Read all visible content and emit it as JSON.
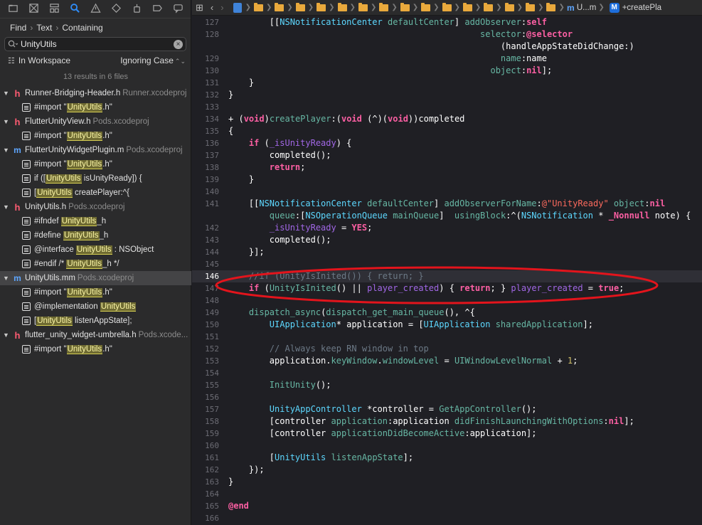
{
  "navigator": {
    "tabs": [
      {
        "name": "project-navigator-tab",
        "icon": "folder-icon"
      },
      {
        "name": "source-control-tab",
        "icon": "source-control-icon"
      },
      {
        "name": "symbol-navigator-tab",
        "icon": "hierarchy-icon"
      },
      {
        "name": "find-navigator-tab",
        "icon": "search-icon",
        "active": true
      },
      {
        "name": "issue-navigator-tab",
        "icon": "warning-icon"
      },
      {
        "name": "test-navigator-tab",
        "icon": "test-diamond-icon"
      },
      {
        "name": "debug-navigator-tab",
        "icon": "spray-icon"
      },
      {
        "name": "breakpoint-navigator-tab",
        "icon": "breakpoint-icon"
      },
      {
        "name": "report-navigator-tab",
        "icon": "report-bubble-icon"
      }
    ],
    "find_path": [
      "Find",
      "Text",
      "Containing"
    ],
    "search_value": "UnityUtils",
    "scope_label": "In Workspace",
    "case_label": "Ignoring Case",
    "results_summary": "13 results in 6 files",
    "highlight_color": "#6e6a32",
    "results": [
      {
        "type": "file",
        "icon": "h",
        "name": "Runner-Bridging-Header.h",
        "project": "Runner.xcodeproj",
        "matches": [
          {
            "pre": "#import \"",
            "hit": "UnityUtils",
            "post": ".h\""
          }
        ]
      },
      {
        "type": "file",
        "icon": "h",
        "name": "FlutterUnityView.h",
        "project": "Pods.xcodeproj",
        "matches": [
          {
            "pre": "#import \"",
            "hit": "UnityUtils",
            "post": ".h\""
          }
        ]
      },
      {
        "type": "file",
        "icon": "m",
        "name": "FlutterUnityWidgetPlugin.m",
        "project": "Pods.xcodeproj",
        "matches": [
          {
            "pre": "#import \"",
            "hit": "UnityUtils",
            "post": ".h\""
          },
          {
            "pre": "if ([",
            "hit": "UnityUtils",
            "post": " isUnityReady]) {"
          },
          {
            "pre": "[",
            "hit": "UnityUtils",
            "post": " createPlayer:^{"
          }
        ]
      },
      {
        "type": "file",
        "icon": "h",
        "name": "UnityUtils.h",
        "project": "Pods.xcodeproj",
        "matches": [
          {
            "pre": "#ifndef ",
            "hit": "UnityUtils",
            "post": "_h"
          },
          {
            "pre": "#define ",
            "hit": "UnityUtils",
            "post": "_h"
          },
          {
            "pre": "@interface ",
            "hit": "UnityUtils",
            "post": " : NSObject"
          },
          {
            "pre": "#endif /* ",
            "hit": "UnityUtils",
            "post": "_h */"
          }
        ]
      },
      {
        "type": "file",
        "icon": "m",
        "name": "UnityUtils.mm",
        "project": "Pods.xcodeproj",
        "selected": true,
        "matches": [
          {
            "pre": "#import \"",
            "hit": "UnityUtils",
            "post": ".h\""
          },
          {
            "pre": "@implementation ",
            "hit": "UnityUtils",
            "post": ""
          },
          {
            "pre": "[",
            "hit": "UnityUtils",
            "post": " listenAppState];"
          }
        ]
      },
      {
        "type": "file",
        "icon": "h",
        "name": "flutter_unity_widget-umbrella.h",
        "project": "Pods.xcode...",
        "matches": [
          {
            "pre": "#import \"",
            "hit": "UnityUtils",
            "post": ".h\""
          }
        ]
      }
    ]
  },
  "jumpbar": {
    "grid_icon": "grid-icon",
    "back_icon": "chevron-left-icon",
    "forward_icon": "chevron-right-icon",
    "folder_count": 15,
    "file_label": "U...m",
    "method_badge": "M",
    "method_label": "+createPla"
  },
  "editor": {
    "current_line": "146",
    "annotation_color": "#e3141c",
    "lines": [
      {
        "n": "127",
        "html": "        [[<span class='t-cls'>NSNotificationCenter</span> <span class='t-fn'>defaultCenter</span>] <span class='t-fn'>addObserver</span>:<span class='t-kw'>self</span>"
      },
      {
        "n": "128",
        "html": "                                                 <span class='t-fn'>selector</span>:<span class='t-kw'>@selector</span>"
      },
      {
        "n": "",
        "html": "                                                     (handleAppStateDidChange:)"
      },
      {
        "n": "129",
        "html": "                                                     <span class='t-fn'>name</span>:name"
      },
      {
        "n": "130",
        "html": "                                                   <span class='t-fn'>object</span>:<span class='t-kw'>nil</span>];"
      },
      {
        "n": "131",
        "html": "    }"
      },
      {
        "n": "132",
        "html": "}"
      },
      {
        "n": "133",
        "html": ""
      },
      {
        "n": "134",
        "html": "+ (<span class='t-kw'>void</span>)<span class='t-fn'>createPlayer</span>:(<span class='t-kw'>void</span> (^)(<span class='t-kw'>void</span>))completed"
      },
      {
        "n": "135",
        "html": "{"
      },
      {
        "n": "136",
        "html": "    <span class='t-kw'>if</span> (<span class='t-prj'>_isUnityReady</span>) {"
      },
      {
        "n": "137",
        "html": "        completed();"
      },
      {
        "n": "138",
        "html": "        <span class='t-kw'>return</span>;"
      },
      {
        "n": "139",
        "html": "    }"
      },
      {
        "n": "140",
        "html": ""
      },
      {
        "n": "141",
        "html": "    [[<span class='t-cls'>NSNotificationCenter</span> <span class='t-fn'>defaultCenter</span>] <span class='t-fn'>addObserverForName</span>:<span class='t-str'>@\"UnityReady\"</span> <span class='t-fn'>object</span>:<span class='t-kw'>nil</span>"
      },
      {
        "n": "",
        "html": "        <span class='t-fn'>queue</span>:[<span class='t-cls'>NSOperationQueue</span> <span class='t-fn'>mainQueue</span>]  <span class='t-fn'>usingBlock</span>:^(<span class='t-cls'>NSNotification</span> * <span class='t-kw'>_Nonnull</span> note) {"
      },
      {
        "n": "142",
        "html": "        <span class='t-prj'>_isUnityReady</span> = <span class='t-kw'>YES</span>;"
      },
      {
        "n": "143",
        "html": "        completed();"
      },
      {
        "n": "144",
        "html": "    }];"
      },
      {
        "n": "145",
        "html": ""
      },
      {
        "n": "146",
        "html": "    <span class='t-cm'>//if (UnityIsInited()) { return; }</span>"
      },
      {
        "n": "147",
        "html": "    <span class='t-kw'>if</span> (<span class='t-fn'>UnityIsInited</span>() || <span class='t-prj'>player_created</span>) { <span class='t-kw'>return</span>; } <span class='t-prj'>player_created</span> = <span class='t-kw'>true</span>;"
      },
      {
        "n": "148",
        "html": ""
      },
      {
        "n": "149",
        "html": "    <span class='t-fn'>dispatch_async</span>(<span class='t-fn'>dispatch_get_main_queue</span>(), ^{"
      },
      {
        "n": "150",
        "html": "        <span class='t-cls'>UIApplication</span>* application = [<span class='t-cls'>UIApplication</span> <span class='t-fn'>sharedApplication</span>];"
      },
      {
        "n": "151",
        "html": ""
      },
      {
        "n": "152",
        "html": "        <span class='t-cm'>// Always keep RN window in top</span>"
      },
      {
        "n": "153",
        "html": "        application.<span class='t-fn'>keyWindow</span>.<span class='t-fn'>windowLevel</span> = <span class='t-fn'>UIWindowLevelNormal</span> + <span class='t-num'>1</span>;"
      },
      {
        "n": "154",
        "html": ""
      },
      {
        "n": "155",
        "html": "        <span class='t-fn'>InitUnity</span>();"
      },
      {
        "n": "156",
        "html": ""
      },
      {
        "n": "157",
        "html": "        <span class='t-cls'>UnityAppController</span> *controller = <span class='t-fn'>GetAppController</span>();"
      },
      {
        "n": "158",
        "html": "        [controller <span class='t-fn'>application</span>:application <span class='t-fn'>didFinishLaunchingWithOptions</span>:<span class='t-kw'>nil</span>];"
      },
      {
        "n": "159",
        "html": "        [controller <span class='t-fn'>applicationDidBecomeActive</span>:application];"
      },
      {
        "n": "160",
        "html": ""
      },
      {
        "n": "161",
        "html": "        [<span class='t-cls'>UnityUtils</span> <span class='t-fn'>listenAppState</span>];"
      },
      {
        "n": "162",
        "html": "    });"
      },
      {
        "n": "163",
        "html": "}"
      },
      {
        "n": "164",
        "html": ""
      },
      {
        "n": "165",
        "html": "<span class='t-kw'>@end</span>"
      },
      {
        "n": "166",
        "html": ""
      }
    ]
  }
}
